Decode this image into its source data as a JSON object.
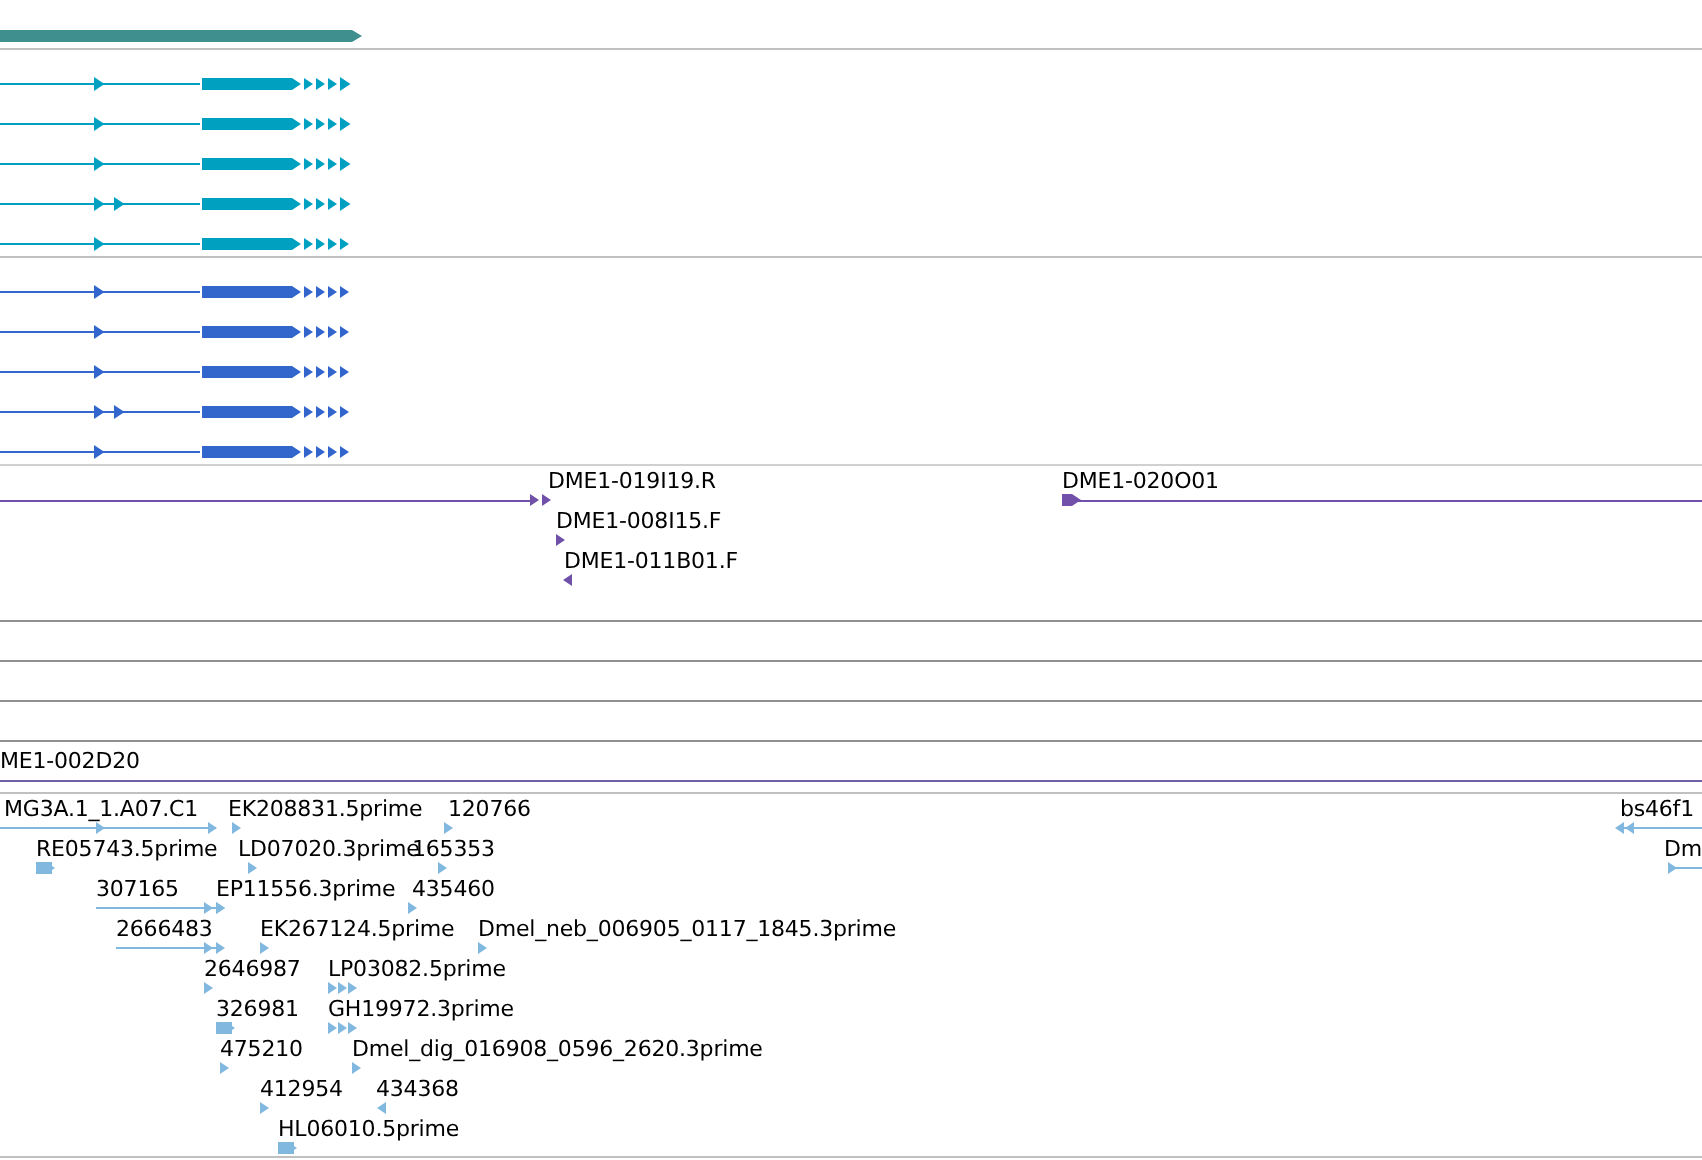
{
  "clone_track": {
    "labels": [
      "DME1-019I19.R",
      "DME1-008I15.F",
      "DME1-011B01.F",
      "DME1-020O01"
    ]
  },
  "clone_track_2": {
    "labels": [
      "ME1-002D20"
    ]
  },
  "est_track": {
    "labels": [
      "MG3A.1_1.A07.C1",
      "EK208831.5prime",
      "120766",
      "RE05743.5prime",
      "LD07020.3prime",
      "165353",
      "307165",
      "EP11556.3prime",
      "435460",
      "2666483",
      "EK267124.5prime",
      "Dmel_neb_006905_0117_1845.3prime",
      "2646987",
      "LP03082.5prime",
      "326981",
      "GH19972.3prime",
      "475210",
      "Dmel_dig_016908_0596_2620.3prime",
      "412954",
      "434368",
      "HL06010.5prime",
      "bs46f1",
      "Dm"
    ]
  }
}
